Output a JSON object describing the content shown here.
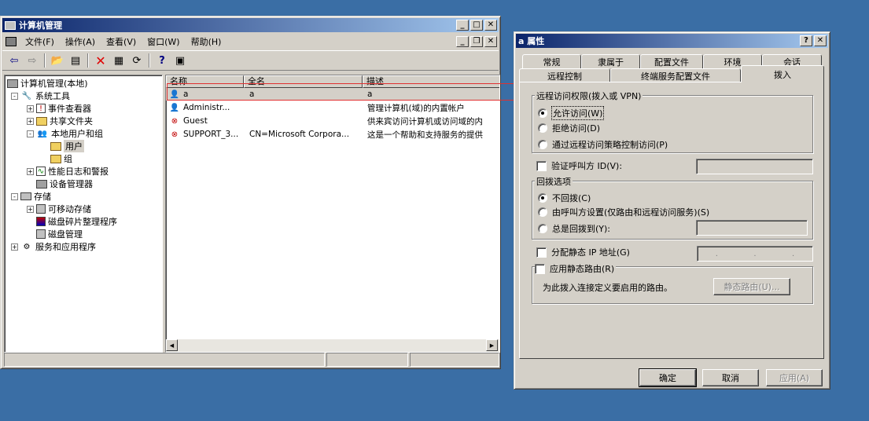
{
  "mmc": {
    "title": "计算机管理",
    "menu": [
      "文件(F)",
      "操作(A)",
      "查看(V)",
      "窗口(W)",
      "帮助(H)"
    ],
    "tree": [
      {
        "label": "计算机管理(本地)",
        "depth": 0,
        "expander": "",
        "icon": "computer-icon"
      },
      {
        "label": "系统工具",
        "depth": 1,
        "expander": "-",
        "icon": "tools-icon"
      },
      {
        "label": "事件查看器",
        "depth": 2,
        "expander": "+",
        "icon": "event-viewer-icon"
      },
      {
        "label": "共享文件夹",
        "depth": 2,
        "expander": "+",
        "icon": "shared-folder-icon"
      },
      {
        "label": "本地用户和组",
        "depth": 2,
        "expander": "-",
        "icon": "users-group-icon"
      },
      {
        "label": "用户",
        "depth": 3,
        "expander": "",
        "icon": "folder-open-icon",
        "selected": true
      },
      {
        "label": "组",
        "depth": 3,
        "expander": "",
        "icon": "folder-icon"
      },
      {
        "label": "性能日志和警报",
        "depth": 2,
        "expander": "+",
        "icon": "performance-icon"
      },
      {
        "label": "设备管理器",
        "depth": 2,
        "expander": "",
        "icon": "device-manager-icon"
      },
      {
        "label": "存储",
        "depth": 1,
        "expander": "-",
        "icon": "storage-icon"
      },
      {
        "label": "可移动存储",
        "depth": 2,
        "expander": "+",
        "icon": "removable-storage-icon"
      },
      {
        "label": "磁盘碎片整理程序",
        "depth": 2,
        "expander": "",
        "icon": "defrag-icon"
      },
      {
        "label": "磁盘管理",
        "depth": 2,
        "expander": "",
        "icon": "disk-management-icon"
      },
      {
        "label": "服务和应用程序",
        "depth": 1,
        "expander": "+",
        "icon": "services-icon"
      }
    ],
    "columns": [
      "名称",
      "全名",
      "描述"
    ],
    "users": [
      {
        "name": "a",
        "fullname": "a",
        "desc": "a",
        "disabled": false
      },
      {
        "name": "Administr...",
        "fullname": "",
        "desc": "管理计算机(域)的内置帐户",
        "disabled": false
      },
      {
        "name": "Guest",
        "fullname": "",
        "desc": "供来宾访问计算机或访问域的内",
        "disabled": true
      },
      {
        "name": "SUPPORT_3...",
        "fullname": "CN=Microsoft Corpora...",
        "desc": "这是一个帮助和支持服务的提供",
        "disabled": true
      }
    ]
  },
  "props": {
    "title": "a 属性",
    "tabs_row1": [
      "常规",
      "隶属于",
      "配置文件",
      "环境",
      "会话"
    ],
    "tabs_row2": [
      "远程控制",
      "终端服务配置文件",
      "拨入"
    ],
    "remote_access": {
      "label": "远程访问权限(拨入或 VPN)",
      "options": [
        "允许访问(W)",
        "拒绝访问(D)",
        "通过远程访问策略控制访问(P)"
      ]
    },
    "verify_caller_id": "验证呼叫方 ID(V):",
    "callback": {
      "label": "回拨选项",
      "options": [
        "不回拨(C)",
        "由呼叫方设置(仅路由和远程访问服务)(S)",
        "总是回拨到(Y):"
      ]
    },
    "static_ip": "分配静态 IP 地址(G)",
    "static_route": "应用静态路由(R)",
    "route_desc": "为此拨入连接定义要启用的路由。",
    "static_route_btn": "静态路由(U)...",
    "ok": "确定",
    "cancel": "取消",
    "apply": "应用(A)"
  }
}
